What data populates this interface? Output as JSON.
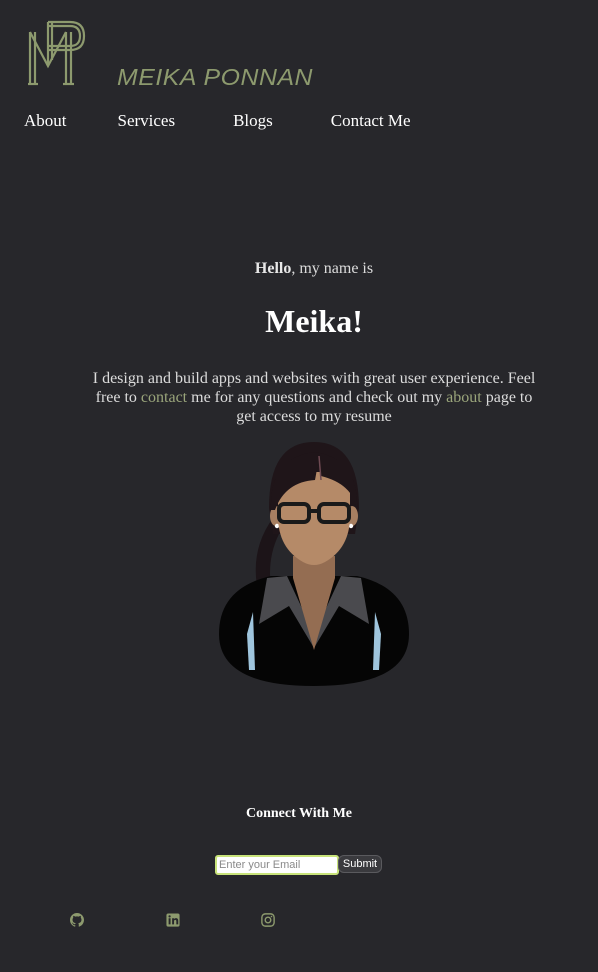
{
  "header": {
    "brand": "MEIKA PONNAN",
    "logo_icon": "mp-monogram-icon",
    "accent_color": "#8d9a6e"
  },
  "nav": {
    "items": [
      "About",
      "Services",
      "Blogs",
      "Contact Me"
    ]
  },
  "hero": {
    "greeting_bold": "Hello",
    "greeting_rest": ", my name is",
    "name": "Meika!",
    "intro_part1": "I design and build apps and websites with great user experience. Feel free to ",
    "contact_link": "contact",
    "intro_part2": " me for any questions and check out my ",
    "about_link": "about",
    "intro_part3": " page to get access to my resume"
  },
  "connect": {
    "title": "Connect With Me",
    "email_placeholder": "Enter your Email",
    "submit_label": "Submit"
  },
  "social": {
    "icons": [
      "github-icon",
      "linkedin-icon",
      "instagram-icon"
    ]
  },
  "colors": {
    "background": "#27272b",
    "link": "#9aa57b",
    "input_border": "#c8e37a"
  }
}
